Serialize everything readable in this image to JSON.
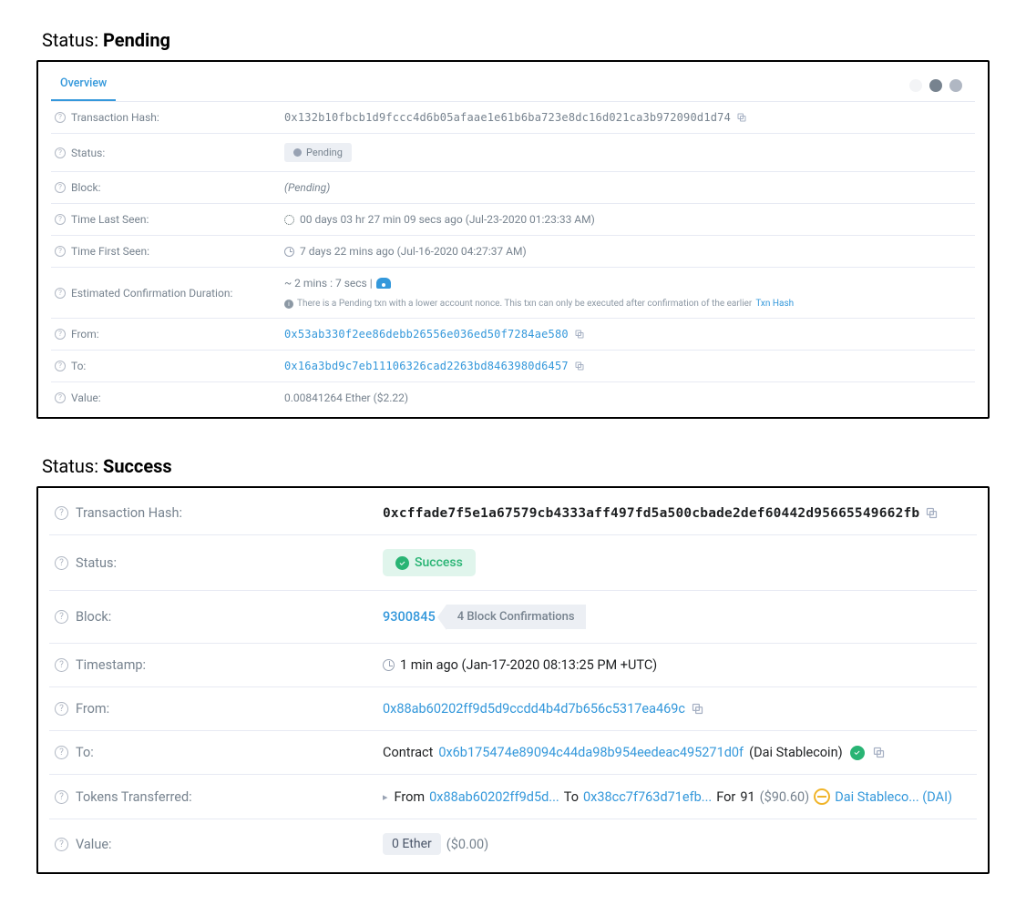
{
  "headings": {
    "status_prefix": "Status: ",
    "pending": "Pending",
    "success": "Success"
  },
  "pending_panel": {
    "tab": "Overview",
    "labels": {
      "tx_hash": "Transaction Hash:",
      "status": "Status:",
      "block": "Block:",
      "time_last_seen": "Time Last Seen:",
      "time_first_seen": "Time First Seen:",
      "est_conf": "Estimated Confirmation Duration:",
      "from": "From:",
      "to": "To:",
      "value": "Value:"
    },
    "values": {
      "tx_hash": "0x132b10fbcb1d9fccc4d6b05afaae1e61b6ba723e8dc16d021ca3b972090d1d74",
      "status_badge": "Pending",
      "block": "(Pending)",
      "time_last_seen": "00 days 03 hr 27 min 09 secs ago (Jul-23-2020 01:23:33 AM)",
      "time_first_seen": "7 days 22 mins ago (Jul-16-2020 04:27:37 AM)",
      "est_conf_prefix": "~ 2 mins : 7 secs | ",
      "est_note": "There is a Pending txn with a lower account nonce. This txn can only be executed after confirmation of the earlier ",
      "est_note_link": "Txn Hash",
      "from": "0x53ab330f2ee86debb26556e036ed50f7284ae580",
      "to": "0x16a3bd9c7eb11106326cad2263bd8463980d6457",
      "value": "0.00841264 Ether ($2.22)"
    }
  },
  "success_panel": {
    "labels": {
      "tx_hash": "Transaction Hash:",
      "status": "Status:",
      "block": "Block:",
      "timestamp": "Timestamp:",
      "from": "From:",
      "to": "To:",
      "tokens": "Tokens Transferred:",
      "value": "Value:"
    },
    "values": {
      "tx_hash": "0xcffade7f5e1a67579cb4333aff497fd5a500cbade2def60442d95665549662fb",
      "status_badge": "Success",
      "block": "9300845",
      "confirmations": "4 Block Confirmations",
      "timestamp": "1 min ago (Jan-17-2020 08:13:25 PM +UTC)",
      "from": "0x88ab60202ff9d5d9ccdd4b4d7b656c5317ea469c",
      "to_prefix": "Contract",
      "to_addr": "0x6b175474e89094c44da98b954eedeac495271d0f",
      "to_name": "(Dai Stablecoin)",
      "tokens_from_label": "From",
      "tokens_from": "0x88ab60202ff9d5d...",
      "tokens_to_label": "To",
      "tokens_to": "0x38cc7f763d71efb...",
      "tokens_for_label": "For",
      "tokens_amount": "91",
      "tokens_usd": "($90.60)",
      "token_name": "Dai Stableco... (DAI)",
      "value_badge": "0 Ether",
      "value_usd": "($0.00)"
    }
  }
}
